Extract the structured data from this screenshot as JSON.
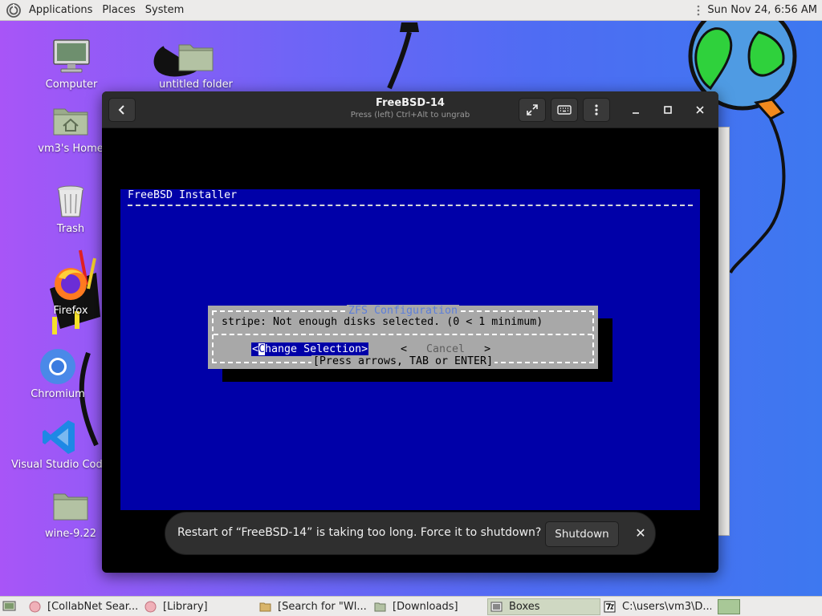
{
  "top_panel": {
    "menus": [
      "Applications",
      "Places",
      "System"
    ],
    "clock": "Sun Nov 24,  6:56 AM"
  },
  "desktop_icons": [
    {
      "label": "Computer",
      "icon": "computer-icon"
    },
    {
      "label": "untitled folder",
      "icon": "folder-icon"
    },
    {
      "label": "vm3's Home",
      "icon": "home-folder-icon"
    },
    {
      "label": "Trash",
      "icon": "trash-icon"
    },
    {
      "label": "Firefox",
      "icon": "firefox-icon"
    },
    {
      "label": "Chromium",
      "icon": "chromium-icon"
    },
    {
      "label": "Visual Studio Code",
      "icon": "vscode-icon"
    },
    {
      "label": "wine-9.22",
      "icon": "folder-icon"
    }
  ],
  "boxes_window": {
    "title": "FreeBSD-14",
    "subtitle": "Press (left) Ctrl+Alt to ungrab",
    "icons": {
      "back": "back-arrow-icon",
      "fullscreen": "fullscreen-icon",
      "keyboard": "keyboard-icon",
      "menu": "kebab-menu-icon",
      "minimize": "minimize-icon",
      "maximize": "maximize-icon",
      "close": "close-icon"
    }
  },
  "vm_console": {
    "installer_title": "FreeBSD Installer",
    "dialog": {
      "caption": "ZFS Configuration",
      "message": "stripe: Not enough disks selected. (0 < 1 minimum)",
      "primary_button": {
        "open": "<",
        "cursor_char": "C",
        "rest": "hange Selection",
        "close": ">"
      },
      "secondary_button": {
        "open": "<",
        "label": "   Cancel   ",
        "close": ">"
      },
      "hint": "[Press arrows, TAB or ENTER]"
    },
    "colors": {
      "background": "#0000a8",
      "dialog": "#a8a8a8",
      "caption": "#5d7fd9"
    }
  },
  "toast": {
    "message": "Restart of “FreeBSD-14” is taking too long. Force it to shutdown?",
    "button": "Shutdown",
    "close": "✕"
  },
  "taskbar": {
    "tasks": [
      {
        "label": "[CollabNet Sear...",
        "icon": "browser-icon",
        "active": false
      },
      {
        "label": "[Library]",
        "icon": "browser-icon",
        "active": false
      },
      {
        "label": "[Search for \"Wl...",
        "icon": "search-folder-icon",
        "active": false
      },
      {
        "label": "[Downloads]",
        "icon": "folder-icon",
        "active": false
      },
      {
        "label": "Boxes",
        "icon": "boxes-icon",
        "active": true
      },
      {
        "label": "C:\\users\\vm3\\D...",
        "icon": "7zip-icon",
        "active": false
      }
    ]
  }
}
